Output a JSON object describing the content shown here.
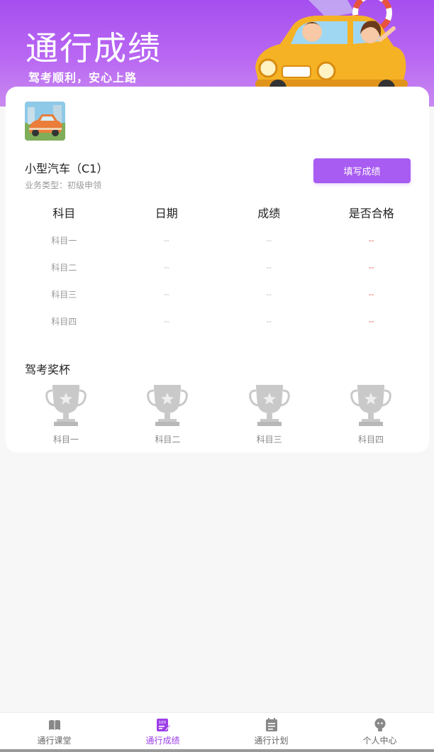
{
  "header": {
    "title": "通行成绩",
    "subtitle": "驾考顺利，安心上路"
  },
  "license": {
    "title": "小型汽车（C1）",
    "business_type": "业务类型：初级申领",
    "fill_button": "填写成绩"
  },
  "table": {
    "headers": [
      "科目",
      "日期",
      "成绩",
      "是否合格"
    ],
    "rows": [
      {
        "subject": "科目一",
        "date": "--",
        "score": "--",
        "pass": "--"
      },
      {
        "subject": "科目二",
        "date": "--",
        "score": "--",
        "pass": "--"
      },
      {
        "subject": "科目三",
        "date": "--",
        "score": "--",
        "pass": "--"
      },
      {
        "subject": "科目四",
        "date": "--",
        "score": "--",
        "pass": "--"
      }
    ]
  },
  "trophies": {
    "title": "驾考奖杯",
    "items": [
      "科目一",
      "科目二",
      "科目三",
      "科目四"
    ]
  },
  "tabbar": {
    "items": [
      {
        "label": "通行课堂",
        "icon": "book-icon",
        "active": false
      },
      {
        "label": "通行成绩",
        "icon": "score-icon",
        "active": true
      },
      {
        "label": "通行计划",
        "icon": "plan-icon",
        "active": false
      },
      {
        "label": "个人中心",
        "icon": "user-icon",
        "active": false
      }
    ]
  },
  "colors": {
    "accent": "#a85cf2",
    "active_tab": "#9c3fe8",
    "fail_dash": "#e35a4b"
  }
}
